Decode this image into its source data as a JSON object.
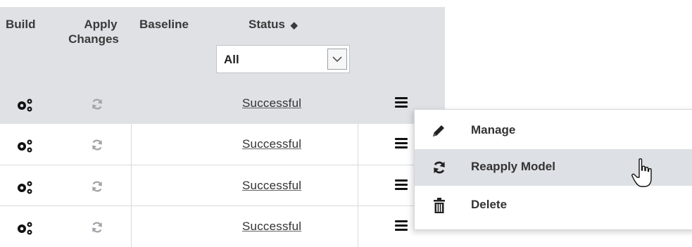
{
  "table": {
    "headers": {
      "build": "Build",
      "apply_changes_line1": "Apply",
      "apply_changes_line2": "Changes",
      "baseline": "Baseline",
      "status": "Status",
      "sort_glyph": "⬍"
    },
    "status_filter": {
      "selected": "All"
    },
    "rows": [
      {
        "status": "Successful"
      },
      {
        "status": "Successful"
      },
      {
        "status": "Successful"
      },
      {
        "status": "Successful"
      }
    ]
  },
  "context_menu": {
    "items": [
      {
        "label": "Manage",
        "icon": "pencil-icon"
      },
      {
        "label": "Reapply Model",
        "icon": "refresh-icon",
        "hovered": true
      },
      {
        "label": "Delete",
        "icon": "trash-icon"
      }
    ]
  },
  "colors": {
    "header_bg": "#dfe1e5",
    "hover_bg": "#dde0e4",
    "text": "#333333"
  }
}
